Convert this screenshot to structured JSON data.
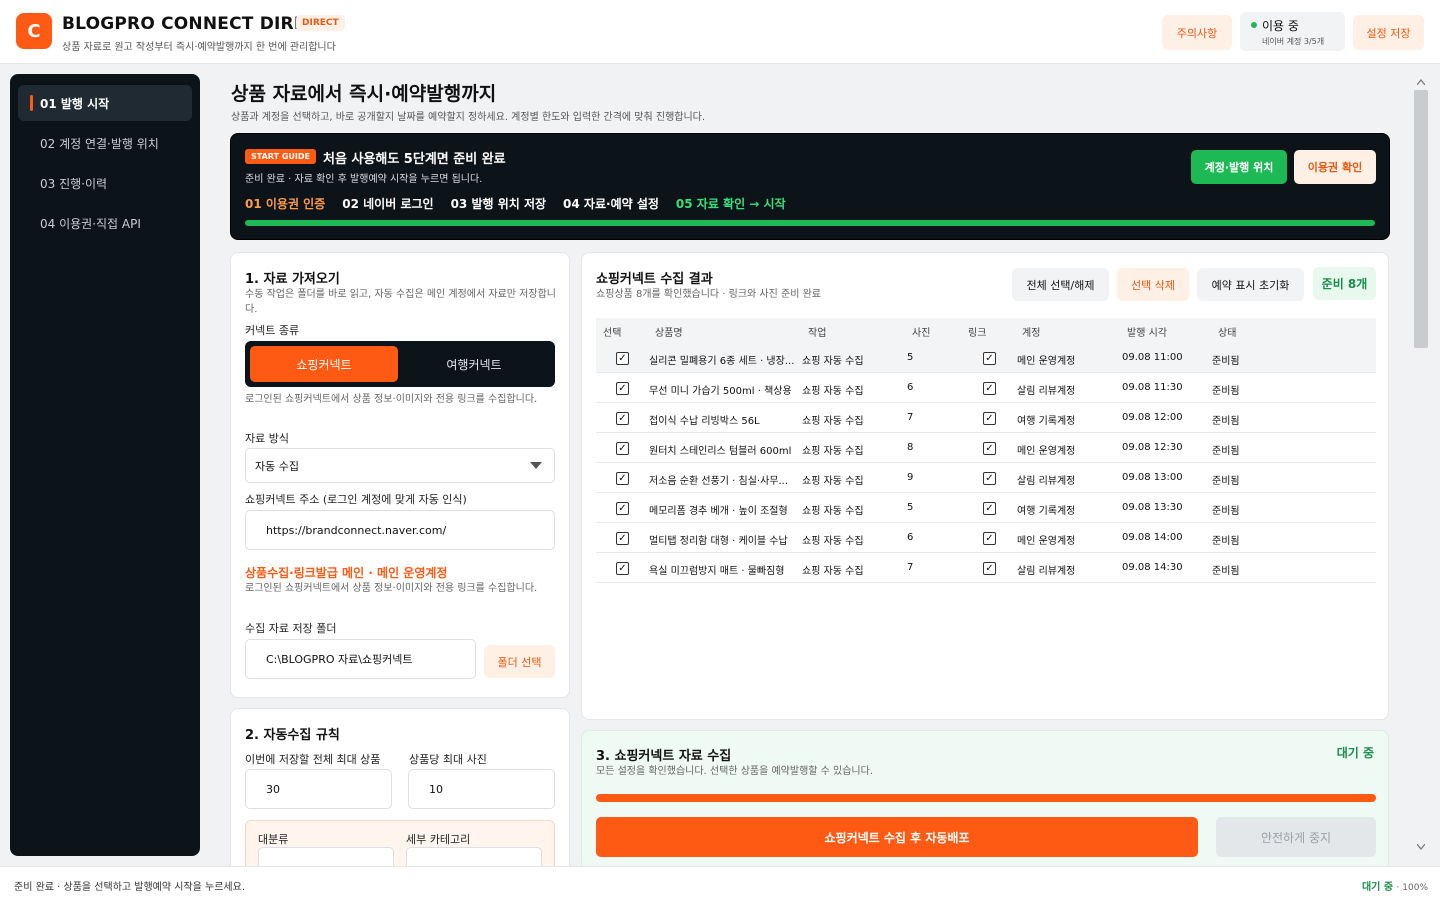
{
  "header": {
    "logo_letter": "C",
    "title": "BLOGPRO CONNECT DIRECT",
    "badge": "DIRECT",
    "subtitle": "상품 자료로 원고 작성부터 즉시·예약발행까지 한 번에 관리합니다",
    "caution_label": "주의사항",
    "status_main": "이용 중",
    "status_sub": "네이버 계정 3/5개",
    "save_label": "설정 저장"
  },
  "sidebar": {
    "items": [
      {
        "label": "01  발행 시작"
      },
      {
        "label": "02  계정 연결·발행 위치"
      },
      {
        "label": "03  진행·이력"
      },
      {
        "label": "04  이용권·직접 API"
      }
    ]
  },
  "main": {
    "title": "상품 자료에서 즉시·예약발행까지",
    "subtitle": "상품과 계정을 선택하고, 바로 공개할지 날짜를 예약할지 정하세요. 계정별 한도와 입력한 간격에 맞춰 진행합니다."
  },
  "guide": {
    "badge": "START GUIDE",
    "title": "처음 사용해도 5단계면 준비 완료",
    "subtitle": "준비 완료 · 자료 확인 후 발행예약 시작을 누르면 됩니다.",
    "steps": [
      "01 이용권 인증",
      "02 네이버 로그인",
      "03 발행 위치 저장",
      "04 자료·예약 설정",
      "05 자료 확인 → 시작"
    ],
    "btn_account": "계정·발행 위치",
    "btn_license": "이용권 확인"
  },
  "source_card": {
    "title": "1. 자료 가져오기",
    "subtitle": "수동 작업은 폴더를 바로 읽고, 자동 수집은 메인 계정에서 자료만 저장합니다.",
    "type_label": "커넥트 종류",
    "seg_on": "쇼핑커넥트",
    "seg_off": "여행커넥트",
    "seg_help": "로그인된 쇼핑커넥트에서 상품 정보·이미지와 전용 링크를 수집합니다.",
    "method_label": "자료 방식",
    "method_value": "자동 수집",
    "url_label": "쇼핑커넥트 주소 (로그인 계정에 맞게 자동 인식)",
    "url_value": "https://brandconnect.naver.com/",
    "main_account_title": "상품수집·링크발급 메인 · 메인 운영계정",
    "main_account_help": "로그인된 쇼핑커넥트에서 상품 정보·이미지와 전용 링크를 수집합니다.",
    "folder_label": "수집 자료 저장 폴더",
    "folder_value": "C:\\BLOGPRO 자료\\쇼핑커넥트",
    "folder_btn": "폴더 선택"
  },
  "rules_card": {
    "title": "2. 자동수집 규칙",
    "max_products_label": "이번에 저장할 전체 최대 상품",
    "max_products_value": "30",
    "max_photos_label": "상품당 최대 사진",
    "max_photos_value": "10",
    "category_label": "대분류",
    "subcategory_label": "세부 카테고리"
  },
  "results": {
    "title": "쇼핑커넥트 수집 결과",
    "subtitle": "쇼핑상품 8개를 확인했습니다 · 링크와 사진 준비 완료",
    "btn_select_all": "전체 선택/해제",
    "btn_delete": "선택 삭제",
    "btn_reset": "예약 표시 초기화",
    "ready_badge": "준비 8개",
    "columns": [
      "선택",
      "상품명",
      "작업",
      "사진",
      "링크",
      "계정",
      "발행 시각",
      "상태"
    ],
    "check_glyph": "✓",
    "rows": [
      {
        "name": "실리콘 밀폐용기 6종 세트 · 냉장...",
        "job": "쇼핑 자동 수집",
        "photos": "5",
        "account": "메인 운영계정",
        "time": "09.08 11:00",
        "status": "준비됨"
      },
      {
        "name": "무선 미니 가습기 500ml · 책상용",
        "job": "쇼핑 자동 수집",
        "photos": "6",
        "account": "살림 리뷰계정",
        "time": "09.08 11:30",
        "status": "준비됨"
      },
      {
        "name": "접이식 수납 리빙박스 56L",
        "job": "쇼핑 자동 수집",
        "photos": "7",
        "account": "여행 기록계정",
        "time": "09.08 12:00",
        "status": "준비됨"
      },
      {
        "name": "원터치 스테인리스 텀블러 600ml",
        "job": "쇼핑 자동 수집",
        "photos": "8",
        "account": "메인 운영계정",
        "time": "09.08 12:30",
        "status": "준비됨"
      },
      {
        "name": "저소음 순환 선풍기 · 침실·사무...",
        "job": "쇼핑 자동 수집",
        "photos": "9",
        "account": "살림 리뷰계정",
        "time": "09.08 13:00",
        "status": "준비됨"
      },
      {
        "name": "메모리폼 경추 베개 · 높이 조절형",
        "job": "쇼핑 자동 수집",
        "photos": "5",
        "account": "여행 기록계정",
        "time": "09.08 13:30",
        "status": "준비됨"
      },
      {
        "name": "멀티탭 정리함 대형 · 케이블 수납",
        "job": "쇼핑 자동 수집",
        "photos": "6",
        "account": "메인 운영계정",
        "time": "09.08 14:00",
        "status": "준비됨"
      },
      {
        "name": "욕실 미끄럼방지 매트 · 물빠짐형",
        "job": "쇼핑 자동 수집",
        "photos": "7",
        "account": "살림 리뷰계정",
        "time": "09.08 14:30",
        "status": "준비됨"
      }
    ]
  },
  "collect": {
    "title": "3. 쇼핑커넥트 자료 수집",
    "subtitle": "모든 설정을 확인했습니다. 선택한 상품을 예약발행할 수 있습니다.",
    "state": "대기 중",
    "progress": 1.0,
    "btn_go": "쇼핑커넥트 수집 후 자동배포",
    "btn_stop": "안전하게 중지"
  },
  "footer": {
    "message": "준비 완료 · 상품을 선택하고 발행예약 시작을 누르세요.",
    "state": "대기 중",
    "zoom": "100%"
  },
  "colors": {
    "accent": "#ff5a14",
    "success": "#1db954",
    "dark": "#0d1419"
  }
}
